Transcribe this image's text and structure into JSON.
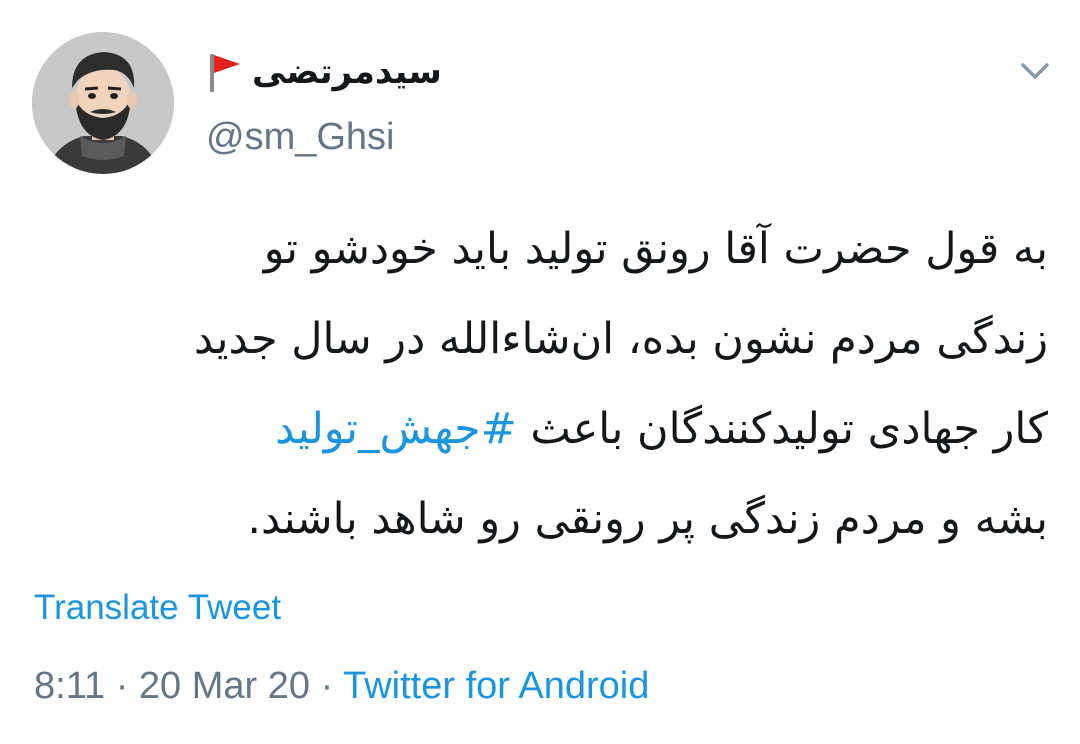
{
  "tweet": {
    "display_name": "سیدمرتضی",
    "username": "@sm_Ghsi",
    "name_emoji": "red-triangular-flag",
    "body_lines": [
      "به قول حضرت آقا رونق تولید باید خودشو تو",
      "زندگی مردم نشون بده، ان‌شاءالله در سال جدید"
    ],
    "line3_prefix": "کار جهادی تولیدکنندگان باعث ",
    "hashtag": "#جهش_تولید",
    "line4": "بشه و مردم زندگی پر رونقی رو شاهد باشند.",
    "translate_label": "Translate Tweet",
    "time": "8:11",
    "date": "20 Mar 20",
    "separator": "·",
    "source": "Twitter for Android"
  },
  "colors": {
    "link": "#1b95e0",
    "secondary": "#657786",
    "text": "#14171a"
  },
  "icons": {
    "menu": "chevron-down-icon",
    "flag": "red-flag-icon"
  }
}
